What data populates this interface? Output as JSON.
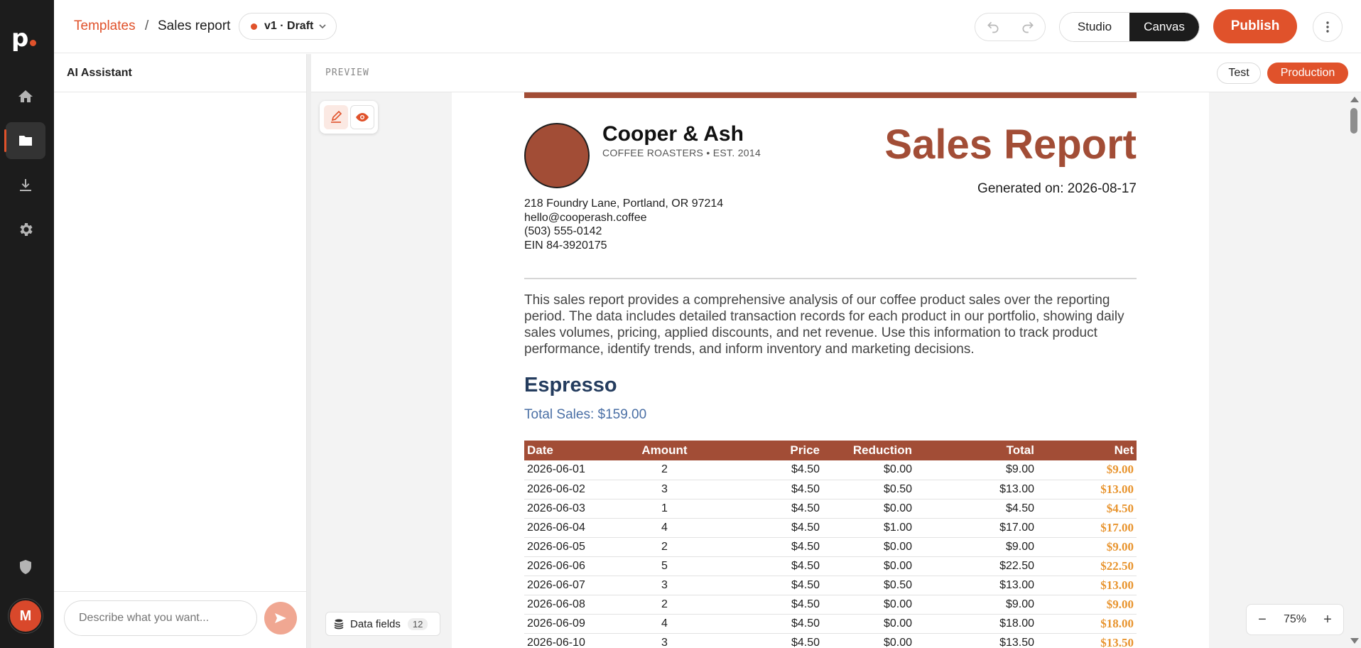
{
  "nav": {
    "logo_letter": "p",
    "items": [
      {
        "name": "home",
        "icon": "home-icon",
        "active": false
      },
      {
        "name": "templates",
        "icon": "folder-icon",
        "active": true
      },
      {
        "name": "downloads",
        "icon": "download-icon",
        "active": false
      },
      {
        "name": "settings",
        "icon": "gear-icon",
        "active": false
      }
    ],
    "bottom_icon": "shield-icon",
    "avatar_initial": "M"
  },
  "header": {
    "breadcrumb_link": "Templates",
    "breadcrumb_separator": "/",
    "breadcrumb_current": "Sales report",
    "version_label": "v1 · Draft",
    "mode_studio": "Studio",
    "mode_canvas": "Canvas",
    "mode_selected": "Canvas",
    "publish_label": "Publish"
  },
  "ai_panel": {
    "title": "AI Assistant",
    "input_placeholder": "Describe what you want..."
  },
  "preview": {
    "label": "PREVIEW",
    "env_test": "Test",
    "env_production": "Production",
    "env_selected": "Production",
    "data_fields_label": "Data fields",
    "data_fields_count": "12",
    "zoom_minus": "−",
    "zoom_level": "75%",
    "zoom_plus": "+"
  },
  "document": {
    "company_name": "Cooper & Ash",
    "company_tagline": "COFFEE ROASTERS • EST. 2014",
    "report_title": "Sales Report",
    "generated_on": "Generated on: 2026-08-17",
    "address_line1": "218 Foundry Lane, Portland, OR 97214",
    "email": "hello@cooperash.coffee",
    "phone": "(503) 555-0142",
    "ein": "EIN 84-3920175",
    "intro": "This sales report provides a comprehensive analysis of our coffee product sales over the reporting period. The data includes detailed transaction records for each product in our portfolio, showing daily sales volumes, pricing, applied discounts, and net revenue. Use this information to track product performance, identify trends, and inform inventory and marketing decisions.",
    "section_title": "Espresso",
    "total_sales": "Total Sales: $159.00",
    "table": {
      "columns": [
        "Date",
        "Amount",
        "Price",
        "Reduction",
        "Total",
        "Net"
      ],
      "rows": [
        [
          "2026-06-01",
          "2",
          "$4.50",
          "$0.00",
          "$9.00",
          "$9.00"
        ],
        [
          "2026-06-02",
          "3",
          "$4.50",
          "$0.50",
          "$13.00",
          "$13.00"
        ],
        [
          "2026-06-03",
          "1",
          "$4.50",
          "$0.00",
          "$4.50",
          "$4.50"
        ],
        [
          "2026-06-04",
          "4",
          "$4.50",
          "$1.00",
          "$17.00",
          "$17.00"
        ],
        [
          "2026-06-05",
          "2",
          "$4.50",
          "$0.00",
          "$9.00",
          "$9.00"
        ],
        [
          "2026-06-06",
          "5",
          "$4.50",
          "$0.00",
          "$22.50",
          "$22.50"
        ],
        [
          "2026-06-07",
          "3",
          "$4.50",
          "$0.50",
          "$13.00",
          "$13.00"
        ],
        [
          "2026-06-08",
          "2",
          "$4.50",
          "$0.00",
          "$9.00",
          "$9.00"
        ],
        [
          "2026-06-09",
          "4",
          "$4.50",
          "$0.00",
          "$18.00",
          "$18.00"
        ],
        [
          "2026-06-10",
          "3",
          "$4.50",
          "$0.00",
          "$13.50",
          "$13.50"
        ]
      ]
    }
  },
  "colors": {
    "accent": "#e0522b",
    "rail_bg": "#1c1c1c",
    "brand_rust": "#a24d36",
    "section_navy": "#243c5e",
    "total_blue": "#4a6fa5",
    "net_orange": "#e8942e"
  }
}
